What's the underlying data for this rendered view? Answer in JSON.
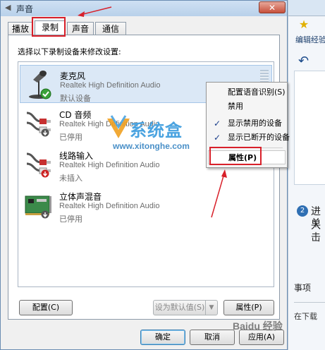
{
  "dialog": {
    "title": "声音",
    "close_glyph": "✕",
    "tabs": [
      "播放",
      "录制",
      "声音",
      "通信"
    ],
    "prompt": "选择以下录制设备来修改设置:",
    "devices": [
      {
        "name": "麦克风",
        "driver": "Realtek High Definition Audio",
        "status": "默认设备",
        "icon": "microphone-icon",
        "badge": "default-check-icon"
      },
      {
        "name": "CD 音频",
        "driver": "Realtek High Definition Audio",
        "status": "已停用",
        "icon": "audio-cable-icon",
        "badge": "disabled-arrow-icon"
      },
      {
        "name": "线路输入",
        "driver": "Realtek High Definition Audio",
        "status": "未插入",
        "icon": "audio-cable-icon",
        "badge": "unplugged-arrow-icon"
      },
      {
        "name": "立体声混音",
        "driver": "Realtek High Definition Audio",
        "status": "已停用",
        "icon": "sound-card-icon",
        "badge": "disabled-arrow-icon"
      }
    ],
    "buttons": {
      "configure": "配置(C)",
      "set_default": "设为默认值(S)",
      "properties": "属性(P)",
      "ok": "确定",
      "cancel": "取消",
      "apply": "应用(A)"
    }
  },
  "context_menu": {
    "items": [
      {
        "label": "配置语音识别(S)",
        "checked": false
      },
      {
        "label": "禁用",
        "checked": false
      },
      {
        "label": "显示禁用的设备",
        "checked": true
      },
      {
        "label": "显示已断开的设备",
        "checked": true
      },
      {
        "label": "属性(P)",
        "checked": false
      }
    ],
    "check_glyph": "✓"
  },
  "background_window": {
    "edit_link": "编辑经验",
    "step_number": "2",
    "step_text_1": "进入",
    "step_text_2": "单击",
    "section": "事项",
    "download": "在下载"
  },
  "watermarks": {
    "site_name": "系统盒",
    "site_url": "www.xitonghe.com",
    "baidu": "Baidu 经验"
  },
  "colors": {
    "annotation_red": "#d8202a",
    "selection": "#dbe8f6",
    "title_bar": "#cfe0f3"
  }
}
